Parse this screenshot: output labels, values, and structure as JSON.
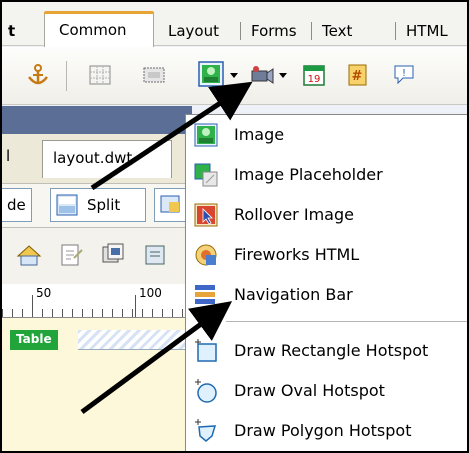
{
  "insert_bar": {
    "tabs": [
      {
        "label": "t"
      },
      {
        "label": "Common"
      },
      {
        "label": "Layout"
      },
      {
        "label": "Forms"
      },
      {
        "label": "Text"
      },
      {
        "label": "HTML"
      }
    ]
  },
  "toolbar": {
    "icons": [
      "anchor-icon",
      "table-grid-icon",
      "layer-icon",
      "image-icon",
      "media-icon",
      "date-icon",
      "server-include-icon",
      "comment-icon"
    ]
  },
  "document": {
    "tab_cut": "l",
    "tab": "layout.dwt",
    "view_buttons": {
      "left_cut": "de",
      "split": "Split"
    },
    "ruler": {
      "marks": [
        "50",
        "100"
      ]
    },
    "table_label": "Table"
  },
  "image_menu": {
    "items": [
      {
        "label": "Image",
        "icon": "image-icon"
      },
      {
        "label": "Image Placeholder",
        "icon": "image-placeholder-icon"
      },
      {
        "label": "Rollover Image",
        "icon": "rollover-image-icon"
      },
      {
        "label": "Fireworks HTML",
        "icon": "fireworks-html-icon"
      },
      {
        "label": "Navigation Bar",
        "icon": "navigation-bar-icon"
      },
      {
        "label": "Draw Rectangle Hotspot",
        "icon": "rectangle-hotspot-icon"
      },
      {
        "label": "Draw Oval Hotspot",
        "icon": "oval-hotspot-icon"
      },
      {
        "label": "Draw Polygon Hotspot",
        "icon": "polygon-hotspot-icon"
      }
    ]
  },
  "colors": {
    "accent_tab": "#e7a436",
    "table_tag": "#21a43a",
    "canvas": "#fdf8d9",
    "arrow": "#000000"
  }
}
